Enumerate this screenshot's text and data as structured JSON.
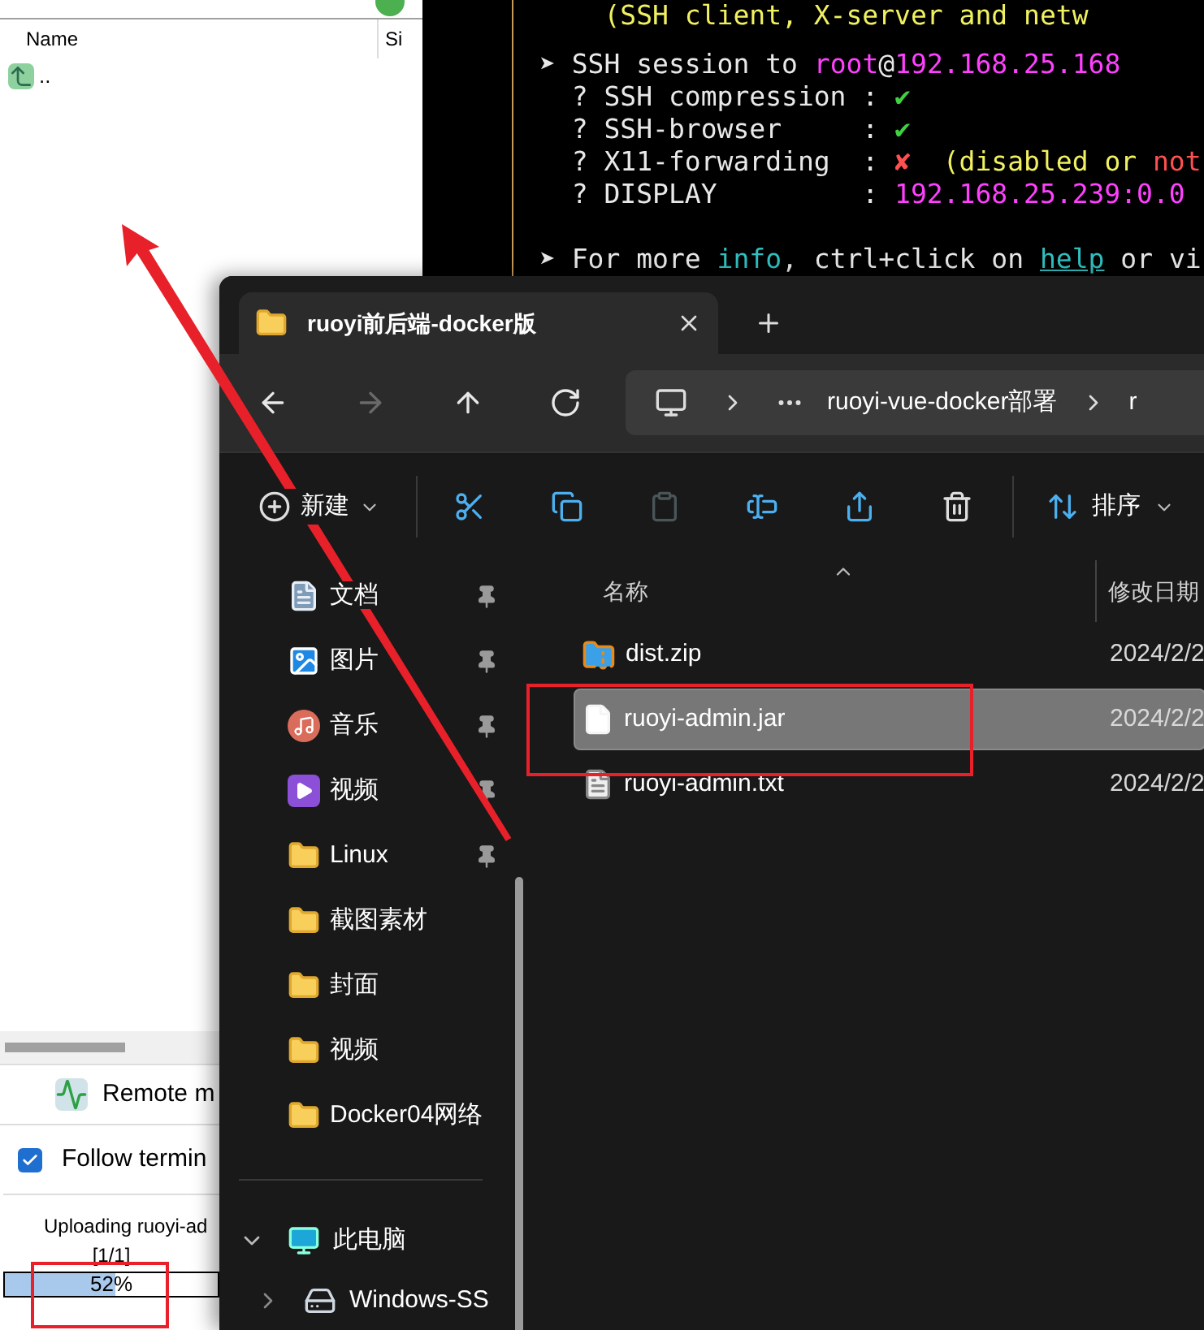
{
  "file_panel": {
    "columns": [
      "Name",
      "Si"
    ],
    "rows": [
      {
        "name": "..",
        "kind": "parent"
      }
    ]
  },
  "remote_monitoring": {
    "label": "Remote m"
  },
  "follow_terminal": {
    "label": "Follow termin",
    "checked": true
  },
  "upload": {
    "status": "Uploading ruoyi-ad",
    "count": "[1/1]",
    "level": 0.52,
    "percent": "52%"
  },
  "terminal": {
    "lines": [
      {
        "kind": "banner",
        "segments": [
          {
            "text": "    (SSH client, X-server and netw",
            "color": "#f0f060"
          }
        ]
      },
      {
        "kind": "prompt",
        "segments": [
          {
            "text": "➤ SSH session to ",
            "color": "#e8e8e8"
          },
          {
            "text": "root",
            "color": "#ff40ff"
          },
          {
            "text": "@",
            "color": "#e8e8e8"
          },
          {
            "text": "192.168.25.168",
            "color": "#ff40ff"
          }
        ]
      },
      {
        "kind": "detail",
        "segments": [
          {
            "text": "  ? SSH compression : ",
            "color": "#e8e8e8"
          },
          {
            "text": "✔",
            "color": "#40d040"
          }
        ]
      },
      {
        "kind": "detail",
        "segments": [
          {
            "text": "  ? SSH-browser     : ",
            "color": "#e8e8e8"
          },
          {
            "text": "✔",
            "color": "#40d040"
          }
        ]
      },
      {
        "kind": "detail",
        "segments": [
          {
            "text": "  ? X11-forwarding  : ",
            "color": "#e8e8e8"
          },
          {
            "text": "✘",
            "color": "#ff5050"
          },
          {
            "text": "  (disabled or ",
            "color": "#f0f060"
          },
          {
            "text": "not",
            "color": "#ff5050"
          }
        ]
      },
      {
        "kind": "detail",
        "segments": [
          {
            "text": "  ? DISPLAY         : ",
            "color": "#e8e8e8"
          },
          {
            "text": "192.168.25.239:0.0",
            "color": "#ff40ff"
          }
        ]
      },
      {
        "kind": "prompt",
        "segments": [
          {
            "text": "➤ For more ",
            "color": "#e8e8e8"
          },
          {
            "text": "info",
            "color": "#30c0c0"
          },
          {
            "text": ", ctrl+click on ",
            "color": "#e8e8e8"
          },
          {
            "text": "help",
            "color": "#30c0c0",
            "underline": true
          },
          {
            "text": " or vi",
            "color": "#e8e8e8"
          }
        ]
      }
    ]
  },
  "explorer": {
    "tab": {
      "title": "ruoyi前后端-docker版"
    },
    "nav": [
      {
        "kind": "back",
        "disabled": false
      },
      {
        "kind": "forward",
        "disabled": true
      },
      {
        "kind": "up",
        "disabled": false
      },
      {
        "kind": "refresh",
        "disabled": false
      }
    ],
    "address": [
      "ruoyi-vue-docker部署",
      "r"
    ],
    "new_button": {
      "label": "新建"
    },
    "toolbar": [
      {
        "kind": "cut",
        "disabled": false
      },
      {
        "kind": "copy",
        "disabled": false
      },
      {
        "kind": "paste",
        "disabled": true
      },
      {
        "kind": "rename",
        "disabled": false
      },
      {
        "kind": "share",
        "disabled": false
      },
      {
        "kind": "delete",
        "disabled": false
      }
    ],
    "sort_button": {
      "label": "排序"
    },
    "sidebar": [
      {
        "label": "文档",
        "kind": "documents",
        "pinned": true
      },
      {
        "label": "图片",
        "kind": "pictures",
        "pinned": true
      },
      {
        "label": "音乐",
        "kind": "music",
        "pinned": true
      },
      {
        "label": "视频",
        "kind": "videos",
        "pinned": true
      },
      {
        "label": "Linux",
        "kind": "folder",
        "pinned": true
      },
      {
        "label": "截图素材",
        "kind": "folder",
        "pinned": false
      },
      {
        "label": "封面",
        "kind": "folder",
        "pinned": false
      },
      {
        "label": "视频",
        "kind": "folder",
        "pinned": false
      },
      {
        "label": "Docker04网络",
        "kind": "folder",
        "pinned": false
      }
    ],
    "tree": [
      {
        "label": "此电脑",
        "kind": "computer",
        "expanded": true,
        "children": [
          {
            "label": "Windows-SS",
            "kind": "drive",
            "expanded": false
          }
        ]
      }
    ],
    "columns": [
      "名称",
      "修改日期"
    ],
    "files": [
      {
        "name": "dist.zip",
        "kind": "archive",
        "modified": "2024/2/2",
        "selected": false
      },
      {
        "name": "ruoyi-admin.jar",
        "kind": "file",
        "modified": "2024/2/2",
        "selected": true
      },
      {
        "name": "ruoyi-admin.txt",
        "kind": "text",
        "modified": "2024/2/2",
        "selected": false
      }
    ]
  }
}
